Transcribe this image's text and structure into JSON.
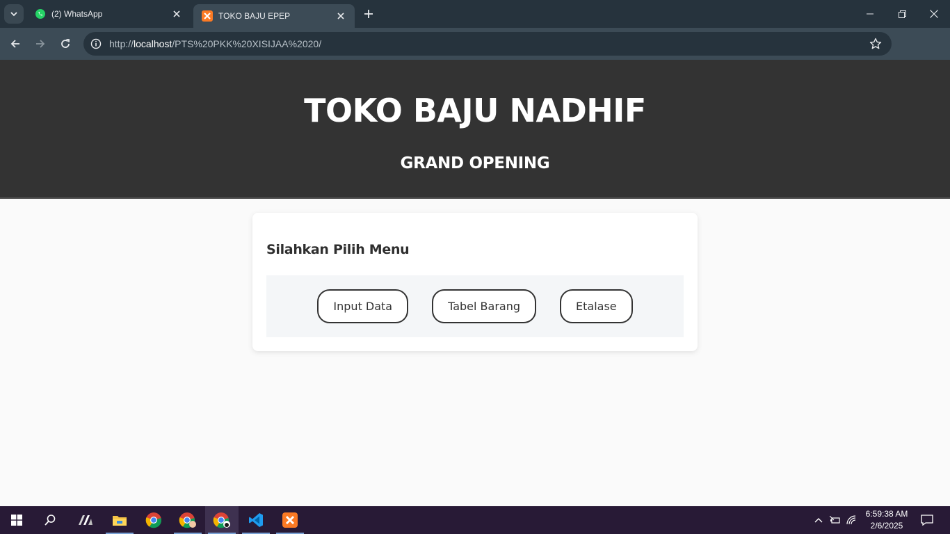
{
  "browser": {
    "tabs": [
      {
        "title": "(2) WhatsApp",
        "icon": "whatsapp-icon",
        "active": false
      },
      {
        "title": "TOKO BAJU EPEP",
        "icon": "xampp-icon",
        "active": true
      }
    ],
    "url_scheme": "http://",
    "url_host": "localhost",
    "url_path": "/PTS%20PKK%20XISIJAA%2020/"
  },
  "page": {
    "header_title": "TOKO BAJU NADHIF",
    "header_subtitle": "GRAND OPENING",
    "menu_heading": "Silahkan Pilih Menu",
    "menu_buttons": [
      "Input Data",
      "Tabel Barang",
      "Etalase"
    ]
  },
  "taskbar": {
    "apps": [
      "windows-start-icon",
      "search-icon",
      "app-launcher-icon",
      "file-explorer-icon",
      "chrome-icon",
      "chrome-profile-icon",
      "chrome-active-icon",
      "vscode-icon",
      "xampp-icon"
    ],
    "time": "6:59:38 AM",
    "date": "2/6/2025"
  },
  "colors": {
    "header_bg": "#333333",
    "page_bg": "#fafafa",
    "tabbar_bg": "#26333d",
    "toolbar_bg": "#3c4b56",
    "taskbar_bg": "#281a36"
  }
}
